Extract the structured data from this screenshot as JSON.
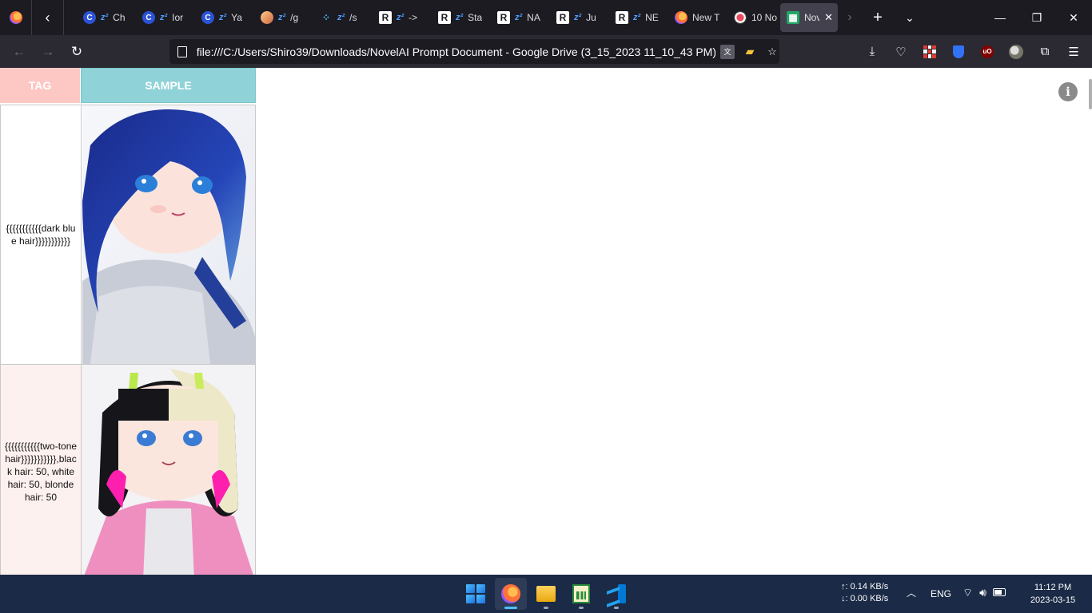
{
  "browser": {
    "tabs": [
      {
        "favicon": "c-circle-icon",
        "title": "Ch"
      },
      {
        "favicon": "c-circle-icon",
        "title": "Ior"
      },
      {
        "favicon": "c-circle-icon",
        "title": "Ya"
      },
      {
        "favicon": "avatar-icon",
        "title": "/g"
      },
      {
        "favicon": "dots-icon",
        "title": "/s"
      },
      {
        "favicon": "r-logo-icon",
        "title": "->"
      },
      {
        "favicon": "r-logo-icon",
        "title": "Sta"
      },
      {
        "favicon": "r-logo-icon",
        "title": "NA"
      },
      {
        "favicon": "r-logo-icon",
        "title": "Ju"
      },
      {
        "favicon": "r-logo-icon",
        "title": "NE"
      },
      {
        "favicon": "firefox-icon",
        "title": "New T"
      },
      {
        "favicon": "sushi-icon",
        "title": "10 No"
      },
      {
        "favicon": "sheets-icon",
        "title": "Nov",
        "active": true
      }
    ],
    "url": "file:///C:/Users/Shiro39/Downloads/NovelAI Prompt Document - Google Drive (3_15_2023 11_10_43 PM).html"
  },
  "sheet": {
    "header": {
      "tag": "TAG",
      "sample": "SAMPLE"
    },
    "rows": [
      {
        "tag": "{{{{{{{{{{{dark blue hair}}}}}}}}}}}",
        "sample_image": "anime-girl-dark-blue-hair"
      },
      {
        "tag": "{{{{{{{{{{{two-tone hair}}}}}}}}}}},black hair: 50, white hair: 50, blonde hair: 50",
        "sample_image": "anime-girl-two-tone-hair"
      }
    ],
    "colors": {
      "tag_header": "#fdc8c4",
      "sample_header": "#8fd2d8",
      "row_alt": "#fdf1ef"
    }
  },
  "taskbar": {
    "apps": [
      "start",
      "firefox",
      "file-explorer",
      "notepad-sheet",
      "vscode"
    ],
    "net_up": "↑: 0.14 KB/s",
    "net_down": "↓: 0.00 KB/s",
    "lang": "ENG",
    "time": "11:12 PM",
    "date": "2023-03-15"
  }
}
